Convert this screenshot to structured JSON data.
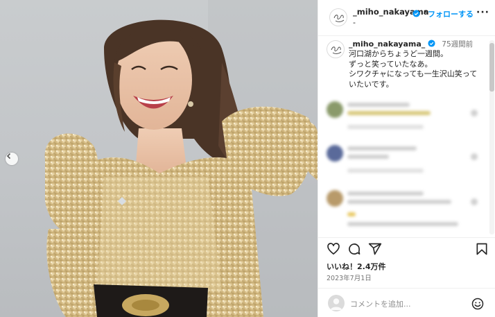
{
  "post": {
    "username": "_miho_nakayama",
    "subline": "-",
    "dot": "•",
    "follow_label": "フォローする",
    "more_label": "···"
  },
  "caption": {
    "username": "_miho_nakayama_",
    "time": "75週間前",
    "lines": [
      "河口湖からちょうど一週間。",
      "ずっと笑っていたなあ。",
      "シワクチャになっても一生沢山笑って",
      "いたいです。"
    ]
  },
  "engagement": {
    "likes": "いいね！2.4万件",
    "date": "2023年7月1日"
  },
  "comment_box": {
    "placeholder": "コメントを追加..."
  },
  "icons": {
    "like": "heart-icon",
    "comment": "comment-icon",
    "share": "send-icon",
    "save": "bookmark-icon",
    "emoji": "emoji-icon",
    "prev": "chevron-left-icon",
    "verified": "verified-badge-icon"
  },
  "colors": {
    "accent": "#0095f6",
    "text": "#262626",
    "muted": "#737373",
    "verified": "#0095f6",
    "dress": "#d9c28c",
    "background": "#c5c8cb"
  }
}
